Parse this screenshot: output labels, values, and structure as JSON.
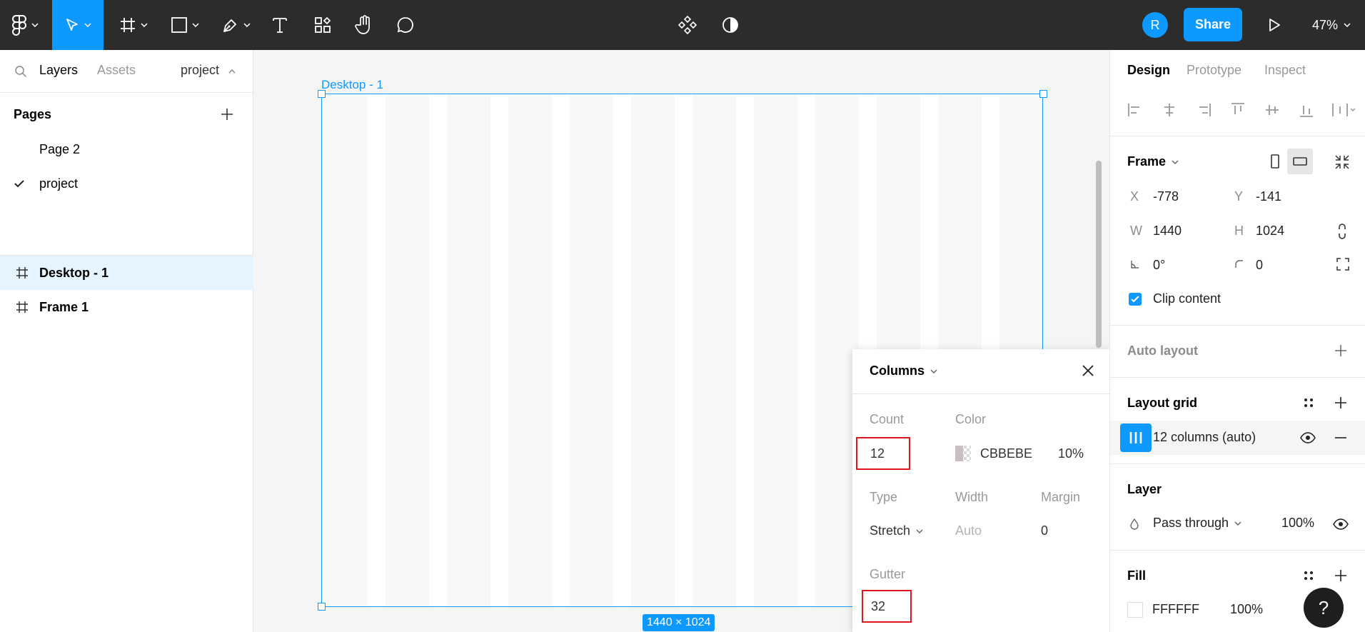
{
  "toolbar": {
    "share_label": "Share",
    "avatar_initial": "R",
    "zoom": "47%",
    "tools": [
      "main-menu",
      "move",
      "frame",
      "shape",
      "pen",
      "text",
      "resources",
      "hand",
      "comment"
    ]
  },
  "left_panel": {
    "tabs": {
      "layers": "Layers",
      "assets": "Assets",
      "project": "project"
    },
    "pages_title": "Pages",
    "pages": [
      {
        "label": "Page 2",
        "current": false
      },
      {
        "label": "project",
        "current": true
      }
    ],
    "layers": [
      {
        "label": "Desktop - 1",
        "selected": true
      },
      {
        "label": "Frame 1",
        "selected": false
      }
    ]
  },
  "canvas": {
    "frame_label": "Desktop - 1",
    "size_badge": "1440 × 1024"
  },
  "grid_popover": {
    "title": "Columns",
    "count_label": "Count",
    "count_value": "12",
    "color_label": "Color",
    "color_hex": "CBBEBE",
    "color_opacity": "10%",
    "type_label": "Type",
    "type_value": "Stretch",
    "width_label": "Width",
    "width_value": "Auto",
    "margin_label": "Margin",
    "margin_value": "0",
    "gutter_label": "Gutter",
    "gutter_value": "32"
  },
  "right_panel": {
    "tabs": {
      "design": "Design",
      "prototype": "Prototype",
      "inspect": "Inspect"
    },
    "frame": {
      "title": "Frame",
      "x_label": "X",
      "x": "-778",
      "y_label": "Y",
      "y": "-141",
      "w_label": "W",
      "w": "1440",
      "h_label": "H",
      "h": "1024",
      "rotation": "0°",
      "radius": "0",
      "clip_content": "Clip content"
    },
    "auto_layout": "Auto layout",
    "layout_grid": {
      "title": "Layout grid",
      "item": "12 columns (auto)"
    },
    "layer": {
      "title": "Layer",
      "blend": "Pass through",
      "opacity": "100%"
    },
    "fill": {
      "title": "Fill",
      "hex": "FFFFFF",
      "opacity": "100%"
    }
  },
  "colors": {
    "accent": "#0d99ff",
    "highlight": "#e0161e",
    "toolbar_bg": "#2c2c2c"
  },
  "help_label": "?"
}
